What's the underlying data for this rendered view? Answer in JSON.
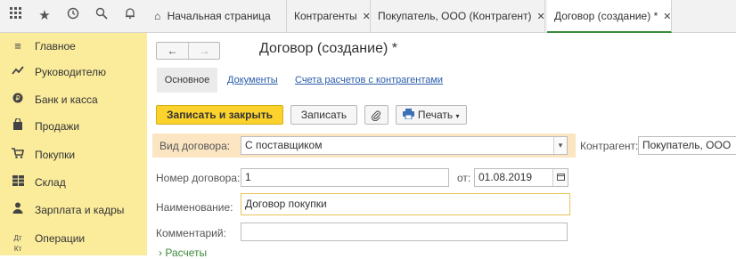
{
  "topbar": {
    "icons": [
      "grid-icon",
      "star-icon",
      "history-icon",
      "search-icon",
      "bell-icon"
    ]
  },
  "tabs": [
    {
      "label": "Начальная страница",
      "icon": "home-icon",
      "closable": false,
      "active": false
    },
    {
      "label": "Контрагенты",
      "closable": true,
      "active": false
    },
    {
      "label": "Покупатель, ООО (Контрагент)",
      "closable": true,
      "active": false
    },
    {
      "label": "Договор (создание) *",
      "closable": true,
      "active": true
    }
  ],
  "tab_close_glyph": "✕",
  "sidebar": {
    "items": [
      {
        "label": "Главное",
        "icon": "menu-icon"
      },
      {
        "label": "Руководителю",
        "icon": "trend-icon"
      },
      {
        "label": "Банк и касса",
        "icon": "bank-icon"
      },
      {
        "label": "Продажи",
        "icon": "bag-icon"
      },
      {
        "label": "Покупки",
        "icon": "cart-icon"
      },
      {
        "label": "Склад",
        "icon": "warehouse-icon"
      },
      {
        "label": "Зарплата и кадры",
        "icon": "person-icon"
      },
      {
        "label": "Операции",
        "icon": "operations-icon"
      }
    ]
  },
  "form": {
    "title": "Договор (создание) *",
    "nav_back": "←",
    "nav_forward": "→",
    "sections": {
      "main": "Основное",
      "documents": "Документы",
      "accounts": "Счета расчетов с контрагентами"
    },
    "toolbar": {
      "save_close": "Записать и закрыть",
      "save": "Записать",
      "print": "Печать"
    },
    "contract_type": {
      "label": "Вид договора:",
      "value": "С поставщиком"
    },
    "counterparty": {
      "label": "Контрагент:",
      "value": "Покупатель, ООО"
    },
    "number": {
      "label": "Номер договора:",
      "value": "1"
    },
    "date": {
      "label": "от:",
      "value": "01.08.2019"
    },
    "name": {
      "label": "Наименование:",
      "value": "Договор покупки"
    },
    "comment": {
      "label": "Комментарий:",
      "value": ""
    },
    "settlements_link": "Расчеты"
  },
  "colors": {
    "sidebar_bg": "#fbec9c",
    "primary_button": "#fcd22d",
    "link": "#2a5caa",
    "active_tab_underline": "#3a8a3a"
  }
}
